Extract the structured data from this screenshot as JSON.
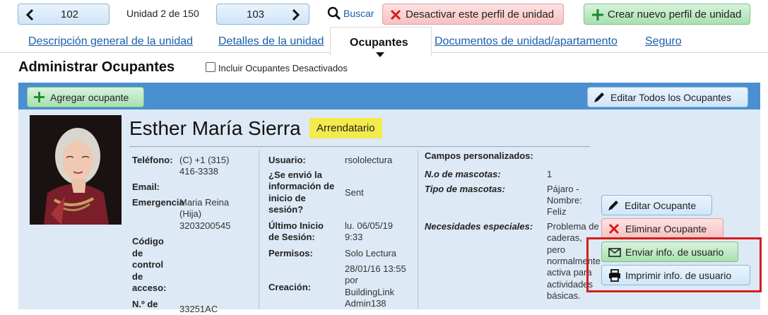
{
  "nav": {
    "prev_unit": "102",
    "unit_position": "Unidad 2 de 150",
    "next_unit": "103",
    "search": "Buscar",
    "deactivate": "Desactivar este perfil de unidad",
    "create": "Crear nuevo perfil de unidad"
  },
  "tabs": [
    {
      "label": "Descripción general de la unidad"
    },
    {
      "label": "Detalles de la unidad"
    },
    {
      "label": "Ocupantes"
    },
    {
      "label": "Documentos de unidad/apartamento"
    },
    {
      "label": "Seguro"
    }
  ],
  "section": {
    "title": "Administrar Ocupantes",
    "include_deactivated": "Incluir Ocupantes Desactivados",
    "add_occupant": "Agregar ocupante",
    "edit_all": "Editar Todos los Ocupantes"
  },
  "occupant": {
    "name": "Esther María Sierra",
    "role_badge": "Arrendatario",
    "phone_label": "Teléfono:",
    "phone_line1": "(C) +1 (315)",
    "phone_line2": "416-3338",
    "email_label": "Email:",
    "emergency_label": "Emergencia",
    "emergency_line1": "Maria Reina",
    "emergency_line2": "(Hija)",
    "emergency_line3": "3203200545",
    "access_label_1": "Código",
    "access_label_2": "de",
    "access_label_3": "control",
    "access_label_4": "de",
    "access_label_5": "acceso:",
    "number_label": "N.º de",
    "number_value": "33251AC",
    "user_label": "Usuario:",
    "user_value": "rsololectura",
    "sent_label_1": "¿Se envió la",
    "sent_label_2": "información de",
    "sent_label_3": "inicio de",
    "sent_label_4": "sesión?",
    "sent_value": "Sent",
    "last_login_label_1": "Último Inicio",
    "last_login_label_2": "de Sesión:",
    "last_login_value_1": "lu. 06/05/19",
    "last_login_value_2": "9:33",
    "permissions_label": "Permisos:",
    "permissions_value": "Solo Lectura",
    "created_label": "Creación:",
    "created_value_1": "28/01/16 13:55",
    "created_value_2": "por",
    "created_value_3": "BuildingLink",
    "created_value_4": "Admin138",
    "custom_fields_label": "Campos personalizados:",
    "pets_count_label": "N.o de mascotas:",
    "pets_count_value": "1",
    "pet_type_label": "Tipo de mascotas:",
    "pet_type_value_1": "Pájaro -",
    "pet_type_value_2": "Nombre:",
    "pet_type_value_3": "Feliz",
    "special_needs_label": "Necesidades especiales:",
    "special_needs_1": "Problema de",
    "special_needs_2": "caderas,",
    "special_needs_3": "pero",
    "special_needs_4": "normalmente",
    "special_needs_5": "activa para",
    "special_needs_6": "actividades",
    "special_needs_7": "básicas."
  },
  "actions": {
    "edit": "Editar Ocupante",
    "delete": "Eliminar Ocupante",
    "send_info": "Enviar info. de usuario",
    "print_info": "Imprimir info. de usuario"
  },
  "colors": {
    "header_bar": "#4a8fd0",
    "panel_bg": "#dde9f5",
    "badge": "#f3ea4b",
    "highlight_box": "#d91c1c"
  }
}
